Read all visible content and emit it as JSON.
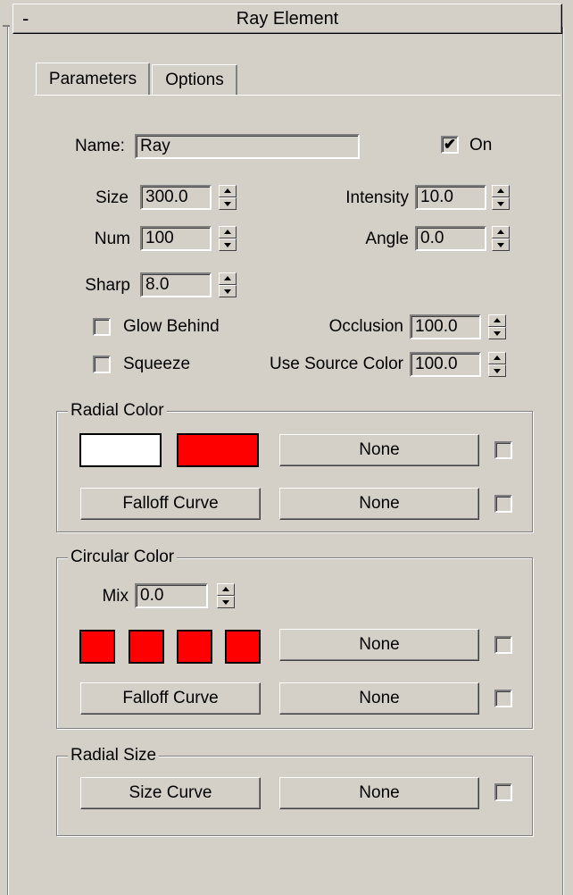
{
  "rollout": {
    "title": "Ray Element",
    "collapse_symbol": "-"
  },
  "tabs": [
    {
      "label": "Parameters",
      "active": true
    },
    {
      "label": "Options",
      "active": false
    }
  ],
  "params": {
    "name_label": "Name:",
    "name_value": "Ray",
    "on_label": "On",
    "on_checked": true,
    "size_label": "Size",
    "size_value": "300.0",
    "intensity_label": "Intensity",
    "intensity_value": "10.0",
    "num_label": "Num",
    "num_value": "100",
    "angle_label": "Angle",
    "angle_value": "0.0",
    "sharp_label": "Sharp",
    "sharp_value": "8.0",
    "glow_behind_label": "Glow Behind",
    "glow_behind_checked": false,
    "squeeze_label": "Squeeze",
    "squeeze_checked": false,
    "occlusion_label": "Occlusion",
    "occlusion_value": "100.0",
    "use_source_color_label": "Use Source Color",
    "use_source_color_value": "100.0"
  },
  "radial_color": {
    "title": "Radial Color",
    "swatch_colors": [
      "#ffffff",
      "#ff0000"
    ],
    "map_button_label": "None",
    "falloff_button_label": "Falloff Curve",
    "falloff_map_label": "None"
  },
  "circular_color": {
    "title": "Circular Color",
    "mix_label": "Mix",
    "mix_value": "0.0",
    "swatch_colors": [
      "#ff0000",
      "#ff0000",
      "#ff0000",
      "#ff0000"
    ],
    "map_button_label": "None",
    "falloff_button_label": "Falloff Curve",
    "falloff_map_label": "None"
  },
  "radial_size": {
    "title": "Radial Size",
    "size_curve_label": "Size Curve",
    "map_button_label": "None"
  }
}
